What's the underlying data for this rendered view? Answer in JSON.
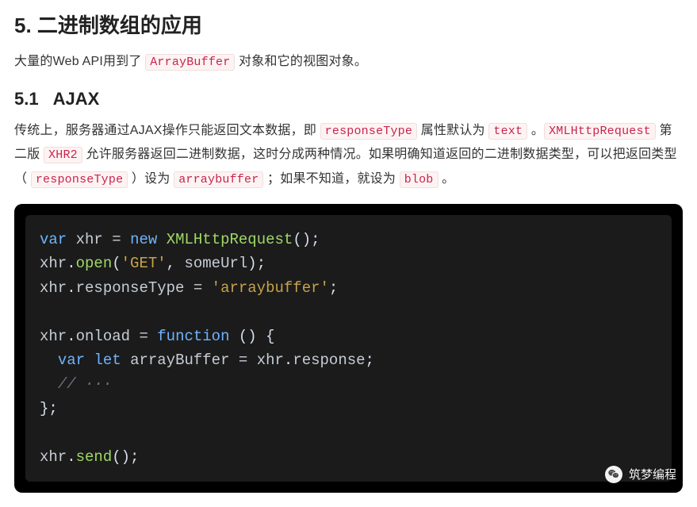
{
  "section": {
    "number": "5.",
    "title": "二进制数组的应用"
  },
  "intro": {
    "before": "大量的Web API用到了 ",
    "code1": "ArrayBuffer",
    "after": " 对象和它的视图对象。"
  },
  "subsection": {
    "number": "5.1",
    "title": "AJAX"
  },
  "para": {
    "t0": "传统上，服务器通过AJAX操作只能返回文本数据，即 ",
    "c1": "responseType",
    "t1": " 属性默认为 ",
    "c2": "text",
    "t2": " 。",
    "c3": "XMLHttpRequest",
    "t3": " 第二版 ",
    "c4": "XHR2",
    "t4": " 允许服务器返回二进制数据，这时分成两种情况。如果明确知道返回的二进制数据类型，可以把返回类型（ ",
    "c5": "responseType",
    "t5": " ）设为 ",
    "c6": "arraybuffer",
    "t6": " ；如果不知道，就设为 ",
    "c7": "blob",
    "t7": " 。"
  },
  "code": {
    "kw_var": "var",
    "kw_new": "new",
    "kw_let": "let",
    "kw_function": "function",
    "id_xhr": "xhr",
    "id_XHR": "XMLHttpRequest",
    "id_open": "open",
    "id_someUrl": "someUrl",
    "id_respType": "responseType",
    "id_onload": "onload",
    "id_arrbuf": "arrayBuffer",
    "id_response": "response",
    "id_send": "send",
    "str_get": "'GET'",
    "str_ab": "'arraybuffer'",
    "cm": "// ···",
    "eq": " = ",
    "dot": ".",
    "op_paren_o": "(",
    "op_paren_c": ")",
    "op_brace_o": " {",
    "op_brace_c": "}",
    "semi": ";",
    "comma": ", ",
    "empty_parens": "()"
  },
  "watermark": {
    "label": "筑梦编程"
  }
}
